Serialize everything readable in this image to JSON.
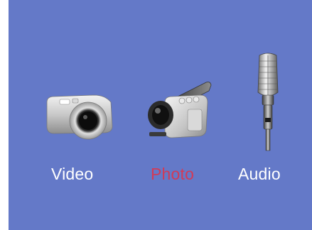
{
  "menu": {
    "selected_color": "#d23a57",
    "background_color": "#6479c8",
    "items": [
      {
        "label": "Video",
        "icon": "digital-camera-icon",
        "selected": false
      },
      {
        "label": "Photo",
        "icon": "camcorder-icon",
        "selected": true
      },
      {
        "label": "Audio",
        "icon": "microphone-icon",
        "selected": false
      }
    ]
  }
}
